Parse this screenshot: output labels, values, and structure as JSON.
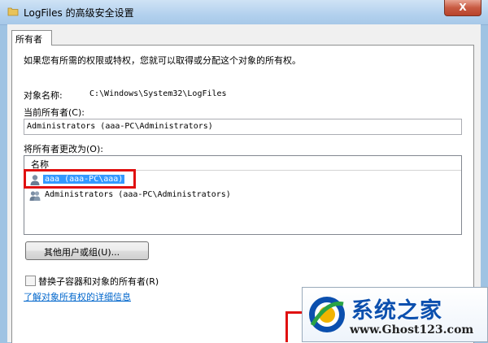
{
  "window": {
    "title": "LogFiles 的高级安全设置",
    "close_label": "X"
  },
  "tab": {
    "label": "所有者"
  },
  "intro_text": "如果您有所需的权限或特权，您就可以取得或分配这个对象的所有权。",
  "object_name": {
    "label": "对象名称:",
    "value": "C:\\Windows\\System32\\LogFiles"
  },
  "current_owner": {
    "label": "当前所有者(C):",
    "value": "Administrators (aaa-PC\\Administrators)"
  },
  "change_owner": {
    "label": "将所有者更改为(O):",
    "column_header": "名称",
    "items": [
      {
        "label": "aaa (aaa-PC\\aaa)",
        "selected": true
      },
      {
        "label": "Administrators (aaa-PC\\Administrators)",
        "selected": false
      }
    ]
  },
  "other_users_button": "其他用户或组(U)...",
  "replace_owner_checkbox": {
    "label": "替换子容器和对象的所有者(R)",
    "checked": false
  },
  "learn_more_link": "了解对象所有权的详细信息",
  "watermark": {
    "title": "系统之家",
    "url": "www.Ghost123.com"
  },
  "colors": {
    "selection": "#3399ff",
    "highlight_frame": "#e01010",
    "link": "#0066cc"
  }
}
